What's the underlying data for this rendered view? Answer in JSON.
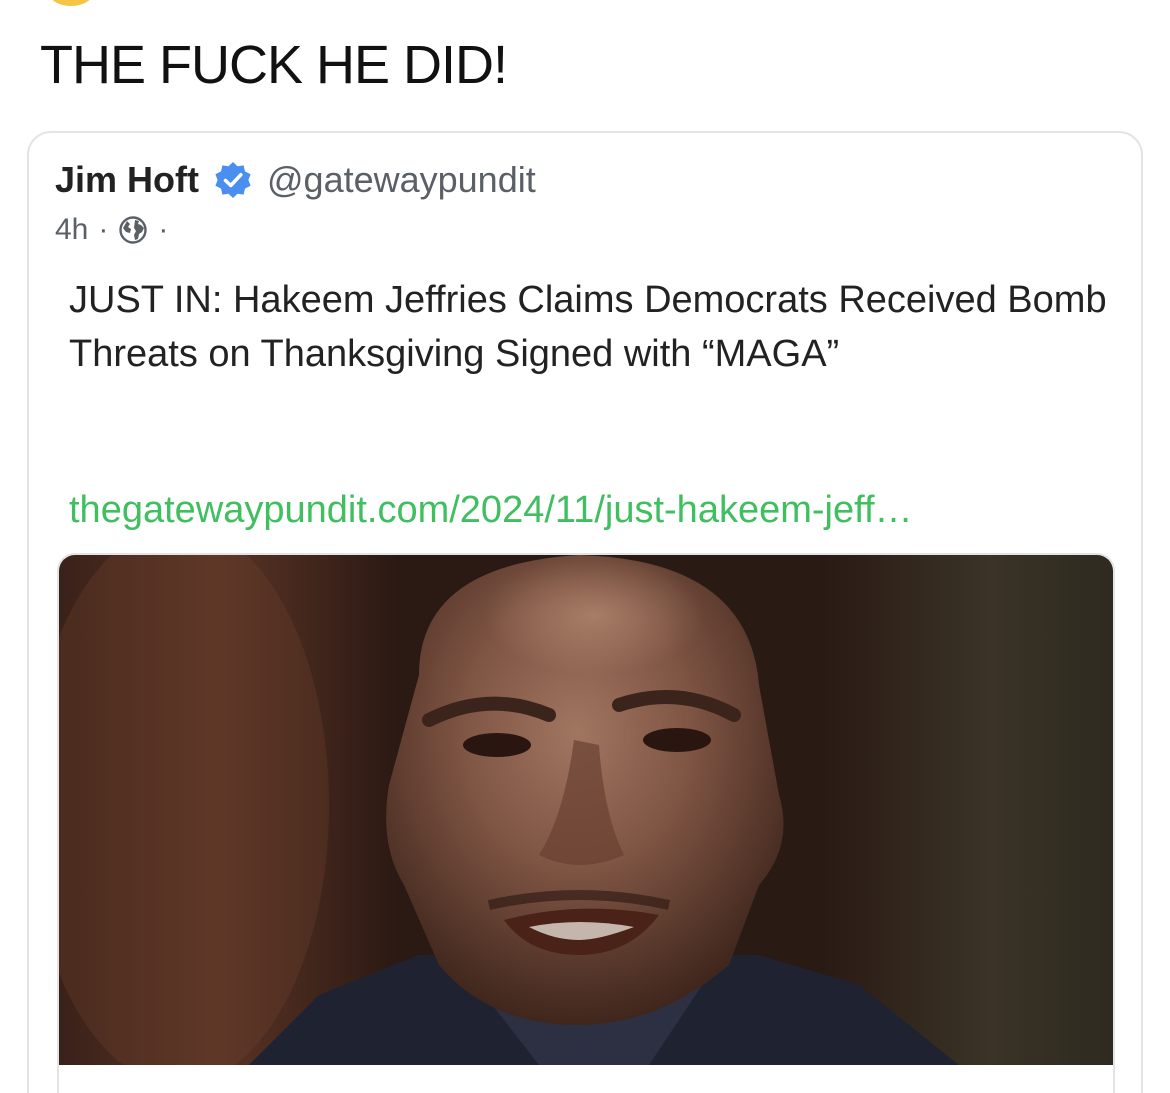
{
  "post": {
    "text": "THE FUCK HE DID!"
  },
  "quoted": {
    "author_name": "Jim Hoft",
    "handle": "@gatewaypundit",
    "time": "4h",
    "separator": "·",
    "headline": "JUST IN: Hakeem Jeffries Claims Democrats Received Bomb Threats on Thanksgiving Signed with “MAGA”",
    "link_text": "thegatewaypundit.com/2024/11/just-hakeem-jeff…",
    "icons": {
      "verified": "verified-badge-icon",
      "audience": "globe-icon"
    },
    "colors": {
      "link": "#3fbf5f",
      "verified": "#4a8ef0"
    }
  }
}
